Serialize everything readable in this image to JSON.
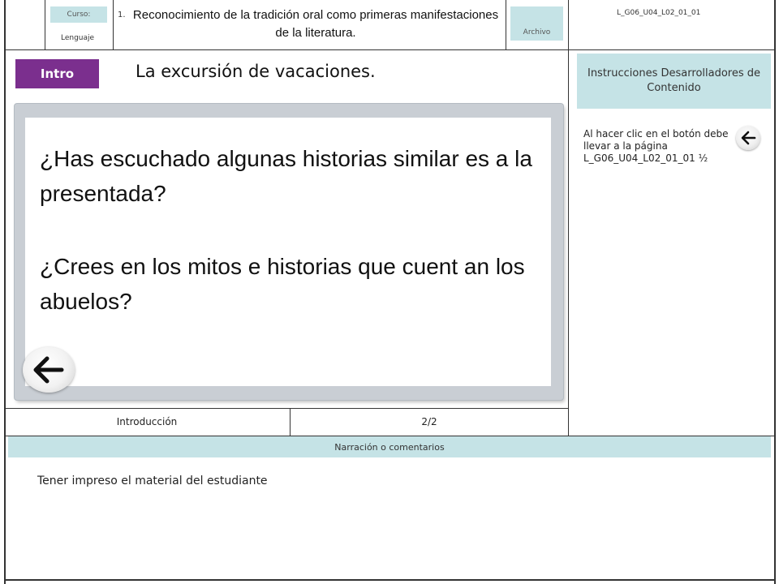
{
  "header": {
    "course_label": "Curso:",
    "course_value": "Lenguaje",
    "item_number": "1.",
    "title": "Reconocimiento de la tradición oral como primeras manifestaciones de la literatura.",
    "file_label": "Archivo",
    "file_code": "L_G06_U04_L02_01_01"
  },
  "slide": {
    "tab_label": "Intro",
    "subtitle": "La excursión de vacaciones.",
    "question_1": "¿Has escuchado algunas historias similar es a la presentada?",
    "question_2": "¿Crees en los mitos e historias que cuent an los abuelos?",
    "back_icon": "back-arrow-icon"
  },
  "footer_row": {
    "section": "Introducción",
    "page": "2/2"
  },
  "instructions": {
    "heading": "Instrucciones Desarrolladores de Contenido",
    "text": "Al hacer clic en el botón debe llevar a la página L_G06_U04_L02_01_01 ½",
    "icon": "back-arrow-icon"
  },
  "narration": {
    "heading": "Narración o comentarios",
    "text": "Tener impreso el material del estudiante"
  },
  "colors": {
    "header_teal": "#c5e3e6",
    "intro_purple": "#7b2f8e",
    "panel_gray": "#c9ced4"
  }
}
